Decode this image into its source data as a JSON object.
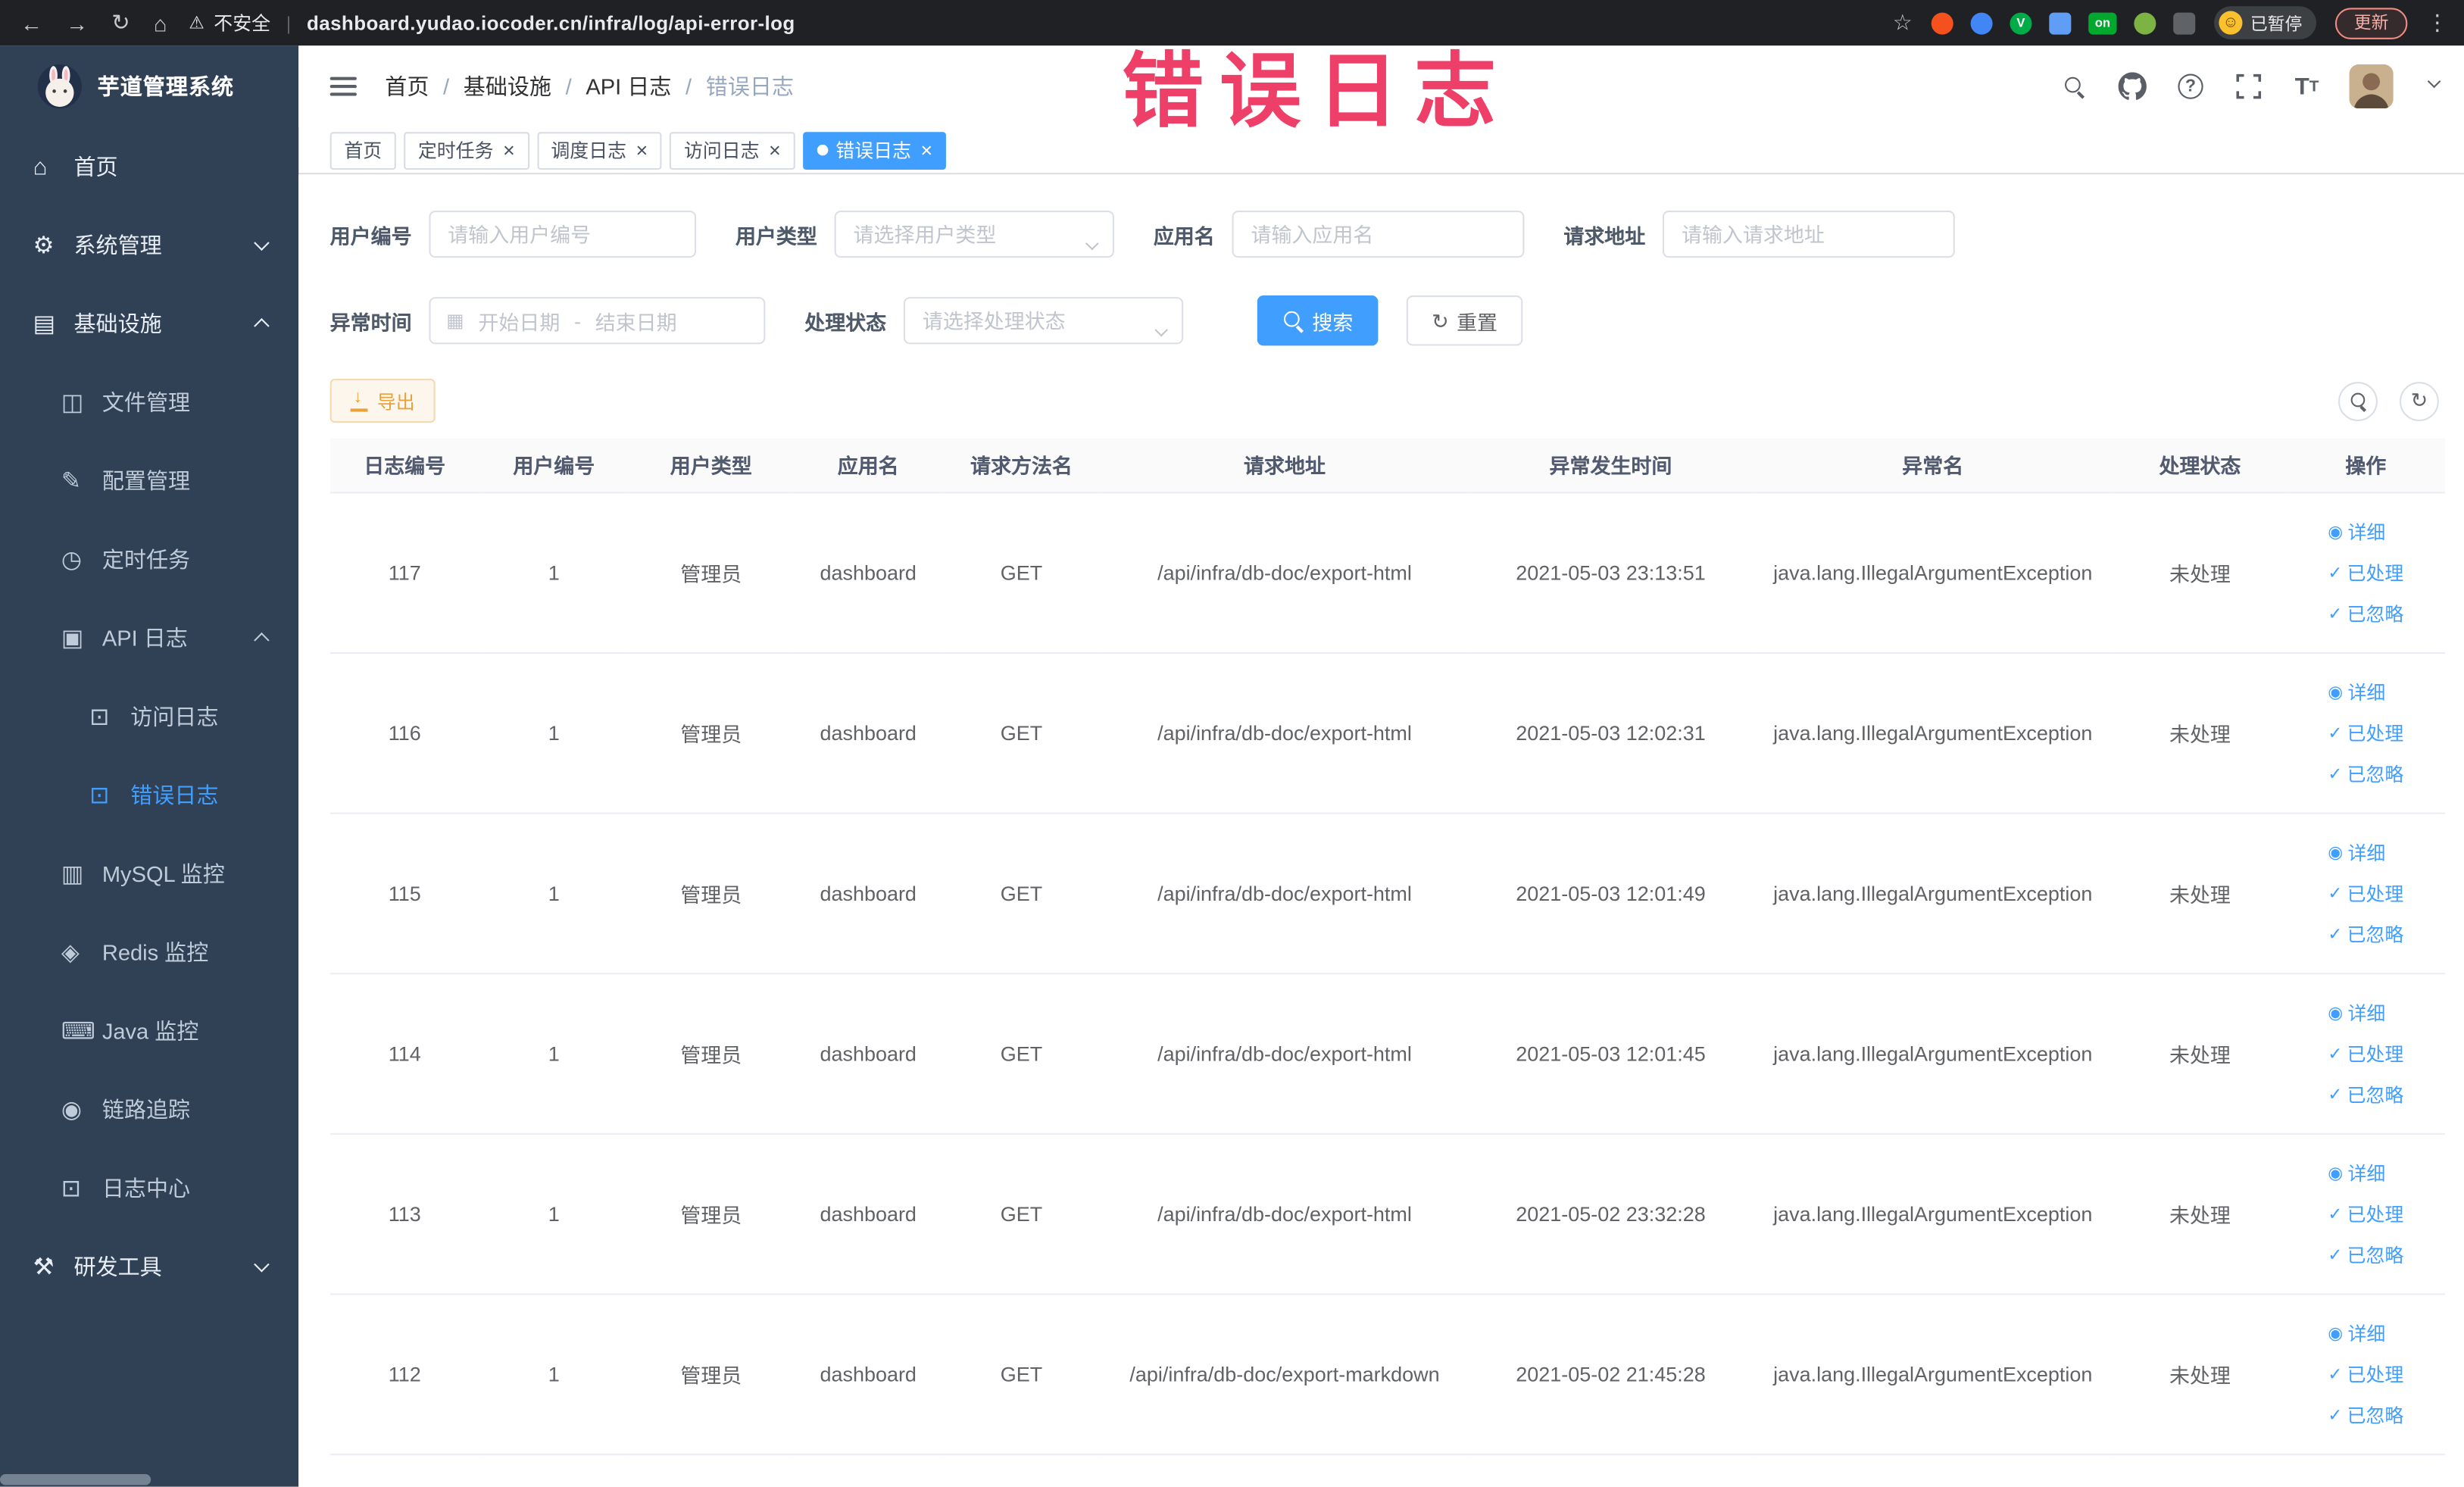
{
  "colors": {
    "primary": "#409EFF",
    "warning_text": "#E6A23C",
    "warning_bg": "#fdf6ec",
    "warning_border": "#f5dab1",
    "annotation": "#ee3f68",
    "sidebar_bg": "#304156",
    "chrome_bg": "#202124"
  },
  "annotation": "错误日志",
  "browser": {
    "security_label": "不安全",
    "url": "dashboard.yudao.iocoder.cn/infra/log/api-error-log",
    "paused_badge": "已暂停",
    "update_button": "更新",
    "extensions": [
      {
        "color": "#f4511e",
        "shape": "circle",
        "glyph": ""
      },
      {
        "color": "#4285f4",
        "shape": "circle",
        "glyph": ""
      },
      {
        "color": "#00ac47",
        "shape": "circle",
        "glyph": "V"
      },
      {
        "color": "#5f9df7",
        "shape": "square",
        "glyph": ""
      },
      {
        "color": "#00a82d",
        "shape": "badge",
        "glyph": "on"
      },
      {
        "color": "#7cb342",
        "shape": "circle",
        "glyph": ""
      },
      {
        "color": "#5f6368",
        "shape": "square",
        "glyph": ""
      }
    ]
  },
  "sidebar": {
    "logo_title": "芋道管理系统",
    "menu": [
      {
        "key": "home",
        "label": "首页",
        "level": 0,
        "icon": "home"
      },
      {
        "key": "system-management",
        "label": "系统管理",
        "level": 0,
        "icon": "gear",
        "chevron": "down"
      },
      {
        "key": "infrastructure",
        "label": "基础设施",
        "level": 0,
        "icon": "monitor",
        "chevron": "up"
      },
      {
        "key": "file-management",
        "label": "文件管理",
        "level": 1,
        "icon": "folder"
      },
      {
        "key": "config-management",
        "label": "配置管理",
        "level": 1,
        "icon": "pencil"
      },
      {
        "key": "scheduled-jobs",
        "label": "定时任务",
        "level": 1,
        "icon": "clock"
      },
      {
        "key": "api-log",
        "label": "API 日志",
        "level": 1,
        "icon": "log",
        "chevron": "up"
      },
      {
        "key": "access-log",
        "label": "访问日志",
        "level": 2,
        "icon": "doc"
      },
      {
        "key": "error-log",
        "label": "错误日志",
        "level": 2,
        "icon": "doc",
        "active": true
      },
      {
        "key": "mysql-monitor",
        "label": "MySQL 监控",
        "level": 1,
        "icon": "database"
      },
      {
        "key": "redis-monitor",
        "label": "Redis 监控",
        "level": 1,
        "icon": "cube"
      },
      {
        "key": "java-monitor",
        "label": "Java 监控",
        "level": 1,
        "icon": "keyboard"
      },
      {
        "key": "trace",
        "label": "链路追踪",
        "level": 1,
        "icon": "eye"
      },
      {
        "key": "log-center",
        "label": "日志中心",
        "level": 1,
        "icon": "doc"
      },
      {
        "key": "dev-tools",
        "label": "研发工具",
        "level": 0,
        "icon": "tools",
        "chevron": "down"
      }
    ]
  },
  "navbar": {
    "breadcrumb": [
      "首页",
      "基础设施",
      "API 日志",
      "错误日志"
    ]
  },
  "tabs": [
    {
      "key": "home",
      "label": "首页",
      "closable": false,
      "active": false
    },
    {
      "key": "job",
      "label": "定时任务",
      "closable": true,
      "active": false
    },
    {
      "key": "job-log",
      "label": "调度日志",
      "closable": true,
      "active": false
    },
    {
      "key": "access-log",
      "label": "访问日志",
      "closable": true,
      "active": false
    },
    {
      "key": "error-log",
      "label": "错误日志",
      "closable": true,
      "active": true
    }
  ],
  "filters": {
    "user_id": {
      "label": "用户编号",
      "placeholder": "请输入用户编号"
    },
    "user_type": {
      "label": "用户类型",
      "placeholder": "请选择用户类型"
    },
    "app_name": {
      "label": "应用名",
      "placeholder": "请输入应用名"
    },
    "request_url": {
      "label": "请求地址",
      "placeholder": "请输入请求地址"
    },
    "exception_time": {
      "label": "异常时间",
      "start_placeholder": "开始日期",
      "separator": "-",
      "end_placeholder": "结束日期"
    },
    "process_status": {
      "label": "处理状态",
      "placeholder": "请选择处理状态"
    },
    "search_button": "搜索",
    "reset_button": "重置"
  },
  "toolbar": {
    "export_button": "导出"
  },
  "table": {
    "columns": [
      "日志编号",
      "用户编号",
      "用户类型",
      "应用名",
      "请求方法名",
      "请求地址",
      "异常发生时间",
      "异常名",
      "处理状态",
      "操作"
    ],
    "actions": {
      "detail": "详细",
      "processed": "已处理",
      "ignored": "已忽略"
    },
    "rows": [
      {
        "log_id": "117",
        "user_id": "1",
        "user_type": "管理员",
        "app_name": "dashboard",
        "method": "GET",
        "url": "/api/infra/db-doc/export-html",
        "time": "2021-05-03 23:13:51",
        "exception": "java.lang.IllegalArgumentException",
        "status": "未处理"
      },
      {
        "log_id": "116",
        "user_id": "1",
        "user_type": "管理员",
        "app_name": "dashboard",
        "method": "GET",
        "url": "/api/infra/db-doc/export-html",
        "time": "2021-05-03 12:02:31",
        "exception": "java.lang.IllegalArgumentException",
        "status": "未处理"
      },
      {
        "log_id": "115",
        "user_id": "1",
        "user_type": "管理员",
        "app_name": "dashboard",
        "method": "GET",
        "url": "/api/infra/db-doc/export-html",
        "time": "2021-05-03 12:01:49",
        "exception": "java.lang.IllegalArgumentException",
        "status": "未处理"
      },
      {
        "log_id": "114",
        "user_id": "1",
        "user_type": "管理员",
        "app_name": "dashboard",
        "method": "GET",
        "url": "/api/infra/db-doc/export-html",
        "time": "2021-05-03 12:01:45",
        "exception": "java.lang.IllegalArgumentException",
        "status": "未处理"
      },
      {
        "log_id": "113",
        "user_id": "1",
        "user_type": "管理员",
        "app_name": "dashboard",
        "method": "GET",
        "url": "/api/infra/db-doc/export-html",
        "time": "2021-05-02 23:32:28",
        "exception": "java.lang.IllegalArgumentException",
        "status": "未处理"
      },
      {
        "log_id": "112",
        "user_id": "1",
        "user_type": "管理员",
        "app_name": "dashboard",
        "method": "GET",
        "url": "/api/infra/db-doc/export-markdown",
        "time": "2021-05-02 21:45:28",
        "exception": "java.lang.IllegalArgumentException",
        "status": "未处理"
      }
    ]
  }
}
